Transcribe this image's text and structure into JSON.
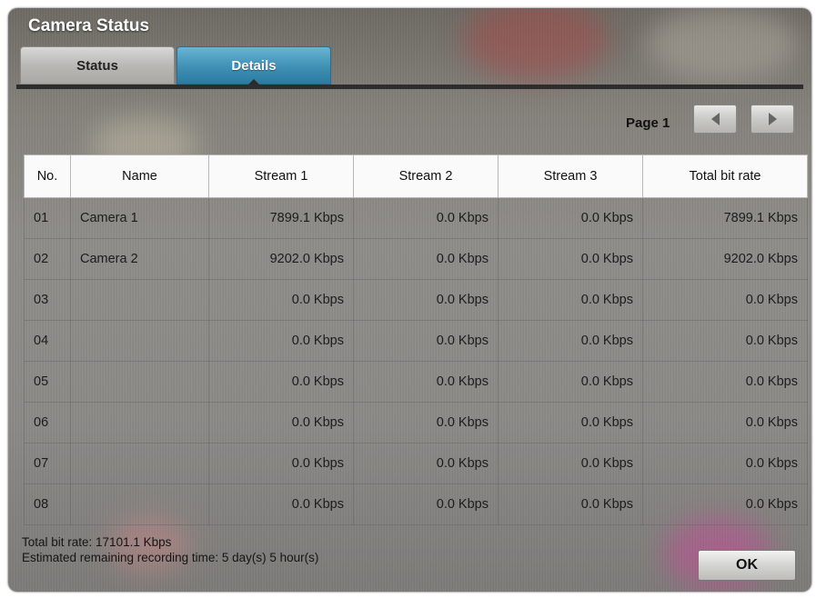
{
  "dialog": {
    "title": "Camera Status"
  },
  "tabs": [
    {
      "label": "Status",
      "active": false
    },
    {
      "label": "Details",
      "active": true
    }
  ],
  "pagination": {
    "label": "Page 1",
    "prev_icon": "triangle-left-icon",
    "next_icon": "triangle-right-icon"
  },
  "table": {
    "headers": [
      "No.",
      "Name",
      "Stream 1",
      "Stream 2",
      "Stream 3",
      "Total bit rate"
    ],
    "rows": [
      [
        "01",
        "Camera 1",
        "7899.1 Kbps",
        "0.0 Kbps",
        "0.0 Kbps",
        "7899.1 Kbps"
      ],
      [
        "02",
        "Camera 2",
        "9202.0 Kbps",
        "0.0 Kbps",
        "0.0 Kbps",
        "9202.0 Kbps"
      ],
      [
        "03",
        "",
        "0.0 Kbps",
        "0.0 Kbps",
        "0.0 Kbps",
        "0.0 Kbps"
      ],
      [
        "04",
        "",
        "0.0 Kbps",
        "0.0 Kbps",
        "0.0 Kbps",
        "0.0 Kbps"
      ],
      [
        "05",
        "",
        "0.0 Kbps",
        "0.0 Kbps",
        "0.0 Kbps",
        "0.0 Kbps"
      ],
      [
        "06",
        "",
        "0.0 Kbps",
        "0.0 Kbps",
        "0.0 Kbps",
        "0.0 Kbps"
      ],
      [
        "07",
        "",
        "0.0 Kbps",
        "0.0 Kbps",
        "0.0 Kbps",
        "0.0 Kbps"
      ],
      [
        "08",
        "",
        "0.0 Kbps",
        "0.0 Kbps",
        "0.0 Kbps",
        "0.0 Kbps"
      ]
    ]
  },
  "footer": {
    "total_bit_rate": "Total bit rate: 17101.1 Kbps",
    "remaining_time": "Estimated remaining recording time: 5 day(s) 5 hour(s)",
    "ok_label": "OK"
  },
  "colors": {
    "accent_tab": "#3f90b4",
    "header_bg": "#fafafa"
  }
}
